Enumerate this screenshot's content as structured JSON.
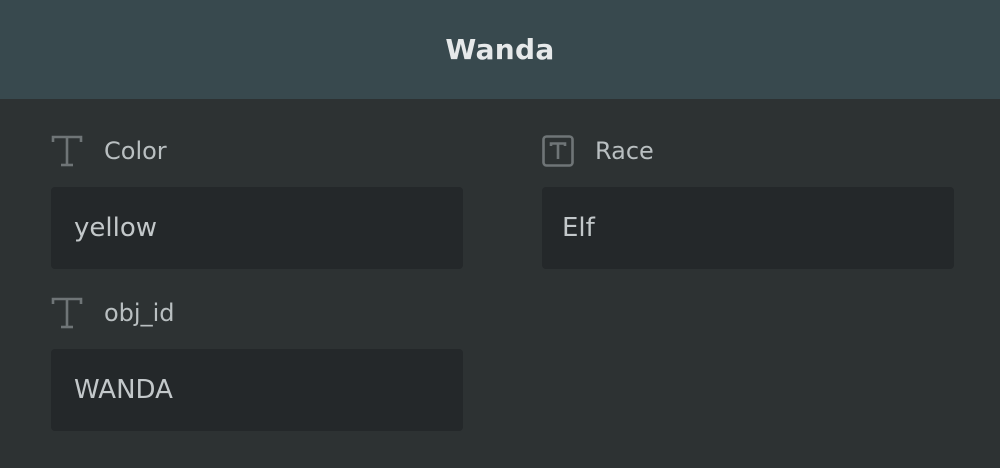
{
  "header": {
    "title": "Wanda"
  },
  "fields": [
    {
      "label": "Color",
      "value": "yellow",
      "icon": "text-type-icon"
    },
    {
      "label": "Race",
      "value": "Elf",
      "icon": "text-box-icon"
    },
    {
      "label": "obj_id",
      "value": "WANDA",
      "icon": "text-type-icon"
    }
  ],
  "colors": {
    "header_bg": "#38494e",
    "body_bg": "#2d3233",
    "field_bg": "#24282a",
    "label_text": "#b9bfc1",
    "icon": "#6f7577"
  }
}
